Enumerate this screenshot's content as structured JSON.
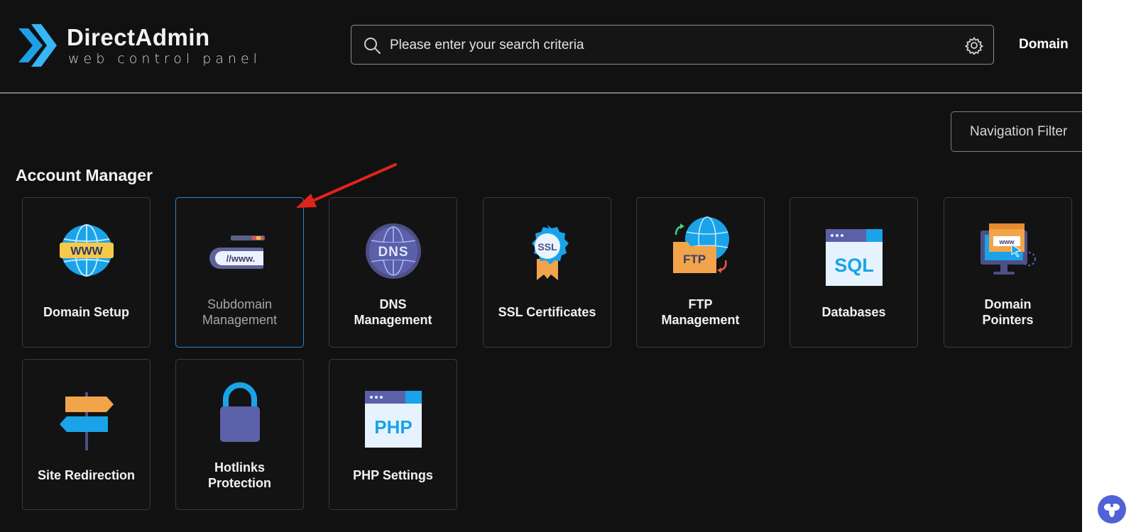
{
  "header": {
    "logo": {
      "title": "DirectAdmin",
      "subtitle": "web control panel"
    },
    "search": {
      "placeholder": "Please enter your search criteria",
      "value": ""
    },
    "domain_label": "Domain"
  },
  "nav_filter_label": "Navigation Filter",
  "section": {
    "title": "Account Manager",
    "tiles": [
      {
        "label": "Domain Setup",
        "icon": "www-globe-icon"
      },
      {
        "label": "Subdomain\nManagement",
        "icon": "subdomain-www-icon",
        "selected": true
      },
      {
        "label": "DNS\nManagement",
        "icon": "dns-globe-icon"
      },
      {
        "label": "SSL Certificates",
        "icon": "ssl-badge-icon"
      },
      {
        "label": "FTP\nManagement",
        "icon": "ftp-folder-icon"
      },
      {
        "label": "Databases",
        "icon": "sql-window-icon"
      },
      {
        "label": "Domain\nPointers",
        "icon": "domain-pointer-icon"
      },
      {
        "label": "Site Redirection",
        "icon": "signpost-icon"
      },
      {
        "label": "Hotlinks\nProtection",
        "icon": "padlock-icon"
      },
      {
        "label": "PHP Settings",
        "icon": "php-window-icon"
      }
    ]
  },
  "colors": {
    "background": "#111112",
    "accent_blue": "#2a86c8",
    "arrow_red": "#e0241b",
    "fab": "#4f63d6"
  }
}
